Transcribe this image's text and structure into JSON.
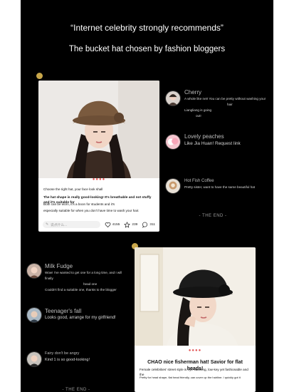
{
  "headline": {
    "line1": "“Internet celebrity strongly recommends”",
    "line2": "The bucket hat chosen by fashion bloggers"
  },
  "colors": {
    "background": "#000000",
    "dot": "#c8a64a",
    "pager": "#e25555"
  },
  "post1": {
    "pager": "●●●●",
    "caption1": "Choose the right hat, your face look shall",
    "caption2": "The hat shape is really good-looking! It's breathable and not stuffy and it's suitable for",
    "caption3": "Both can be worn, it's a boon for students and it's",
    "caption4": "especially suitable for when you don't have time to wash your hair.",
    "comment_placeholder": "说点什么...",
    "likes": "4155",
    "stars": "239",
    "comments": "311"
  },
  "comments_right": [
    {
      "name": "Cherry",
      "text1": "A whole like net! You can be pretty without washing your",
      "text2": "hair",
      "text3": "Liangliang is going",
      "text4": "out!"
    },
    {
      "name": "Lovely peaches",
      "text1": "Like Jia Huan! Request link"
    },
    {
      "name": "Hot Fish Coffee",
      "text1": "Pretty sister, want to have the same beautiful hat"
    }
  ],
  "end1": "- THE END -",
  "comments_left": [
    {
      "name": "Milk Fudge",
      "text1": "Wow! I've wanted to get one for a long time, and I will finally",
      "text2": "head one",
      "text3": "Couldn't find a suitable one, thanks to the blogger"
    },
    {
      "name": "Teenager's fall",
      "text1": "Looks good, arrange for my girlfriend!"
    },
    {
      "name": "Fairy don't be angry",
      "text1": "Kind 1 is so good-looking!"
    }
  ],
  "post2": {
    "pager": "●●●●",
    "caption1": "CHAO nice fisherman hat! Savior for flat heads!",
    "caption2": "Female celebrities' street style is eye-catching, low-key yet fashionable and the",
    "caption3": "Pretty for head shape, flat head friendly, can cover up the hairline. I quickly got it"
  },
  "end2": "- THE END -"
}
